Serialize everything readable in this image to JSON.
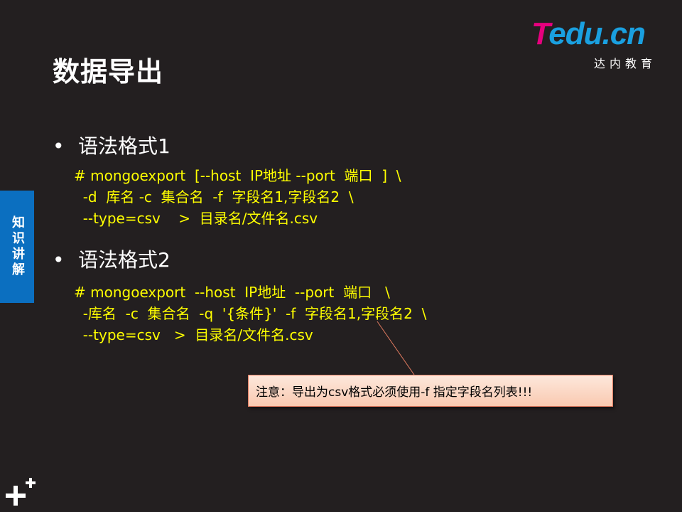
{
  "slide": {
    "title": "数据导出",
    "side_tab": "知识讲解",
    "logo": {
      "mark_t": "T",
      "mark_rest": "edu.cn",
      "subtitle": "达内教育"
    },
    "sections": [
      {
        "heading": "语法格式1",
        "code": "# mongoexport  [--host  IP地址 --port  端口  ]  \\\n  -d  库名 -c  集合名  -f  字段名1,字段名2  \\\n  --type=csv    >  目录名/文件名.csv"
      },
      {
        "heading": "语法格式2",
        "code": "# mongoexport  --host  IP地址  --port  端口   \\\n  -库名  -c  集合名  -q  '{条件}'  -f  字段名1,字段名2  \\\n  --type=csv   >  目录名/文件名.csv"
      }
    ],
    "callout": "注意：导出为csv格式必须使用-f  指定字段名列表!!!"
  }
}
